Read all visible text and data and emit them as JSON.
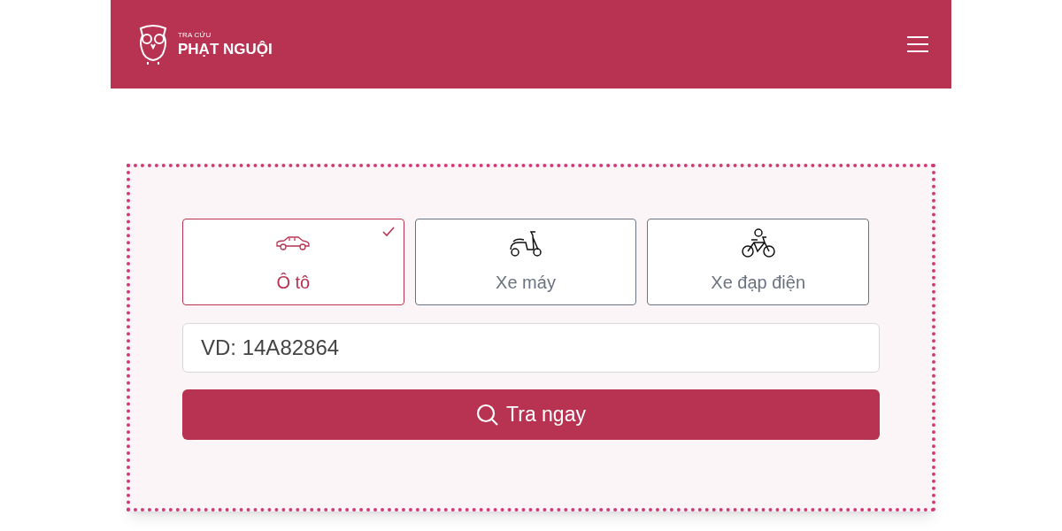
{
  "header": {
    "logo_small": "TRA CỨU",
    "logo_big": "PHẠT NGUỘI"
  },
  "vehicles": [
    {
      "kind": "car",
      "label": "Ô tô",
      "selected": true
    },
    {
      "kind": "scooter",
      "label": "Xe máy",
      "selected": false
    },
    {
      "kind": "ebike",
      "label": "Xe đạp điện",
      "selected": false
    }
  ],
  "search": {
    "placeholder": "VD: 14A82864"
  },
  "button": {
    "label": "Tra ngay"
  }
}
